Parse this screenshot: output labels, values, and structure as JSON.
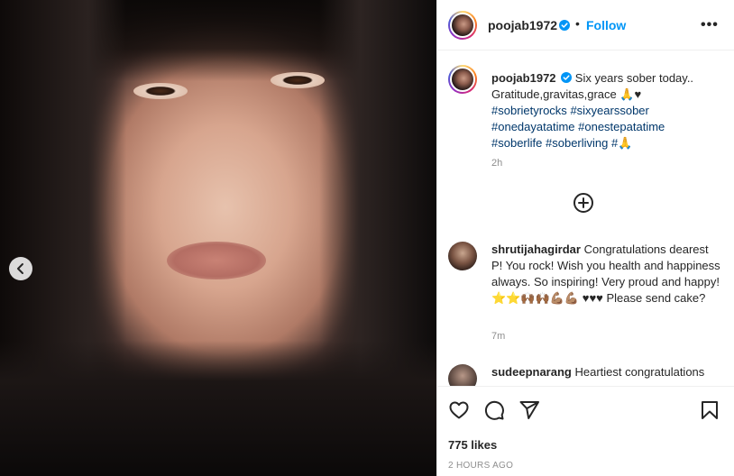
{
  "post": {
    "username": "poojab1972",
    "follow_label": "Follow",
    "separator": "•",
    "more_label": "•••",
    "caption_text": "Six years sober today.. Gratitude,gravitas,grace 🙏♥",
    "hashtags": [
      "#sobrietyrocks",
      "#sixyearssober",
      "#onedayatatime",
      "#onestepatatime",
      "#soberlife",
      "#soberliving",
      "#🙏"
    ],
    "caption_time": "2h",
    "likes": "775 likes",
    "posted_ago": "2 HOURS AGO"
  },
  "comments": [
    {
      "username": "shrutijahagirdar",
      "text": "Congratulations dearest P! You rock! Wish you health and happiness always. So inspiring! Very proud and happy! ⭐⭐🙌🏾🙌🏾💪🏽💪🏽 ♥♥♥ Please send cake?",
      "time": "7m"
    },
    {
      "username": "sudeepnarang",
      "text": "Heartiest congratulations"
    }
  ],
  "icons": {
    "verified": "verified-badge-icon",
    "prev": "chevron-left-icon",
    "load_more": "plus-circle-icon",
    "like": "heart-icon",
    "comment": "comment-icon",
    "share": "share-icon",
    "save": "bookmark-icon"
  },
  "colors": {
    "accent": "#0095f6",
    "verified": "#0095f6",
    "hashtag": "#00376b",
    "muted": "#8e8e8e"
  }
}
